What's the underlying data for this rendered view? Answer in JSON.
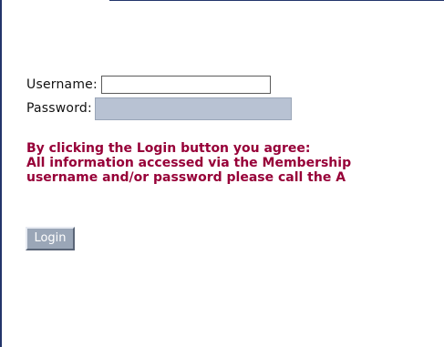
{
  "form": {
    "username_label": "Username:",
    "username_value": "",
    "password_label": "Password:",
    "password_value": ""
  },
  "agreement": {
    "line1": "By clicking the Login button you agree:",
    "line2": "All information accessed via the Membership",
    "line3": "username and/or password please call the A"
  },
  "login_button": {
    "label": "Login"
  },
  "colors": {
    "frame": "#23356b",
    "agreement_text": "#970038",
    "password_field": "#b8c2d3",
    "button_face": "#9aa6b7"
  }
}
